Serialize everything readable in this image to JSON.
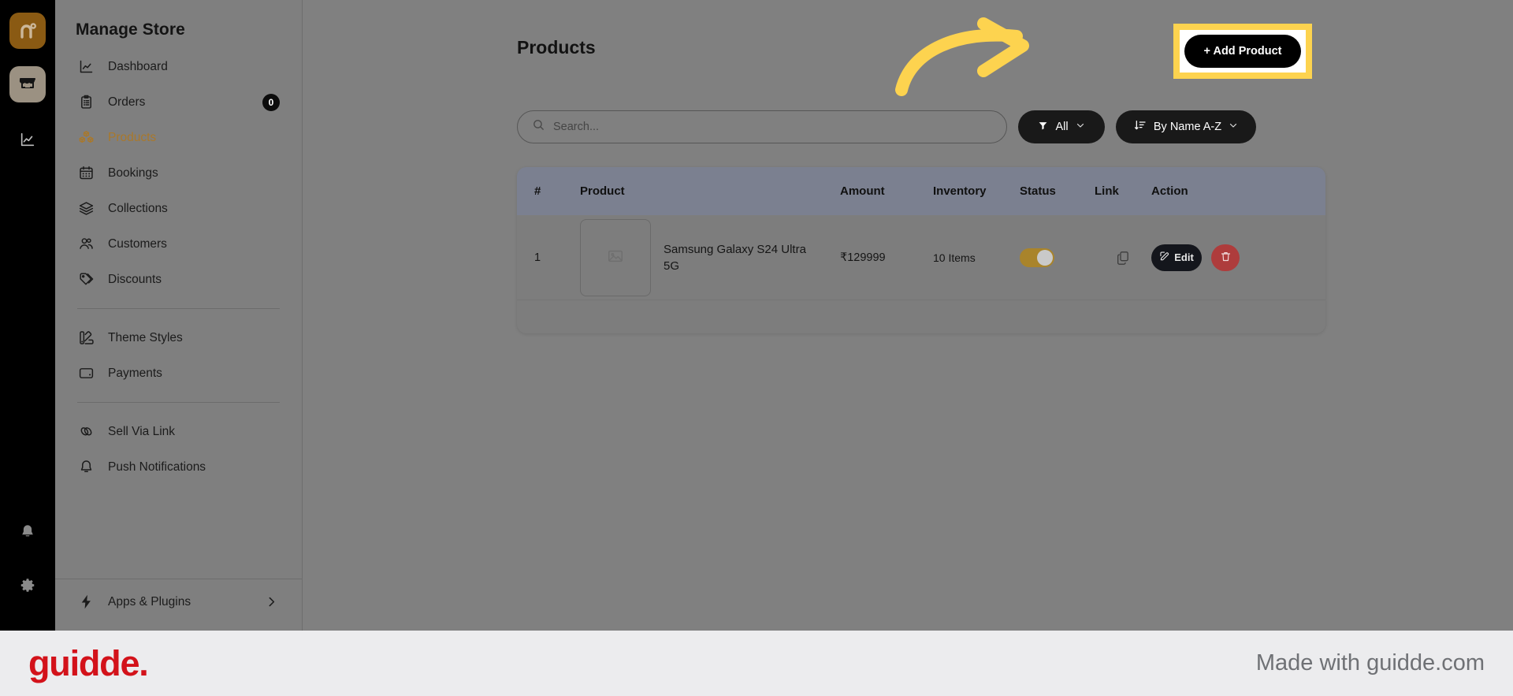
{
  "rail": {
    "logo_icon": "nuvio-n-logo-icon",
    "items": [
      {
        "name": "store-icon",
        "active": true
      },
      {
        "name": "analytics-icon",
        "active": false
      }
    ],
    "bottom": [
      {
        "name": "bell-icon"
      },
      {
        "name": "gear-icon"
      }
    ]
  },
  "sidebar": {
    "title": "Manage Store",
    "items": [
      {
        "label": "Dashboard",
        "icon": "chart-line-icon",
        "active": false,
        "badge": null
      },
      {
        "label": "Orders",
        "icon": "clipboard-icon",
        "active": false,
        "badge": "0"
      },
      {
        "label": "Products",
        "icon": "boxes-icon",
        "active": true,
        "badge": null
      },
      {
        "label": "Bookings",
        "icon": "calendar-icon",
        "active": false,
        "badge": null
      },
      {
        "label": "Collections",
        "icon": "layers-icon",
        "active": false,
        "badge": null
      },
      {
        "label": "Customers",
        "icon": "users-icon",
        "active": false,
        "badge": null
      },
      {
        "label": "Discounts",
        "icon": "tag-icon",
        "active": false,
        "badge": null
      }
    ],
    "group2": [
      {
        "label": "Theme Styles",
        "icon": "palette-icon",
        "active": false
      },
      {
        "label": "Payments",
        "icon": "wallet-icon",
        "active": false
      }
    ],
    "group3": [
      {
        "label": "Sell Via Link",
        "icon": "link-icon",
        "active": false
      },
      {
        "label": "Push Notifications",
        "icon": "bell-icon",
        "active": false
      }
    ],
    "footer": {
      "label": "Apps & Plugins",
      "icon": "lightning-icon",
      "chevron": "chevron-right-icon"
    }
  },
  "main": {
    "page_title": "Products",
    "add_product_label": "+ Add Product",
    "search": {
      "placeholder": "Search...",
      "value": "",
      "icon": "search-icon"
    },
    "filter": {
      "label": "All",
      "icon": "filter-icon",
      "chevron": "chevron-down-icon"
    },
    "sort": {
      "label": "By Name A-Z",
      "icon": "sort-desc-icon",
      "chevron": "chevron-down-icon"
    },
    "table": {
      "columns": [
        "#",
        "Product",
        "Amount",
        "Inventory",
        "Status",
        "Link",
        "Action"
      ],
      "rows": [
        {
          "num": "1",
          "product": "Samsung Galaxy S24 Ultra 5G",
          "amount": "₹129999",
          "inventory": "10 Items",
          "status_on": true,
          "link_icon": "copy-icon",
          "edit_label": "Edit",
          "edit_icon": "pencil-square-icon",
          "delete_icon": "trash-icon",
          "thumb_icon": "image-placeholder-icon"
        }
      ]
    }
  },
  "annotation": {
    "arrow_color": "#fdd34f",
    "highlight_color": "#fdd34f"
  },
  "footer": {
    "logo_text": "guidde.",
    "made_with": "Made with guidde.com",
    "logo_color": "#d3121a"
  }
}
